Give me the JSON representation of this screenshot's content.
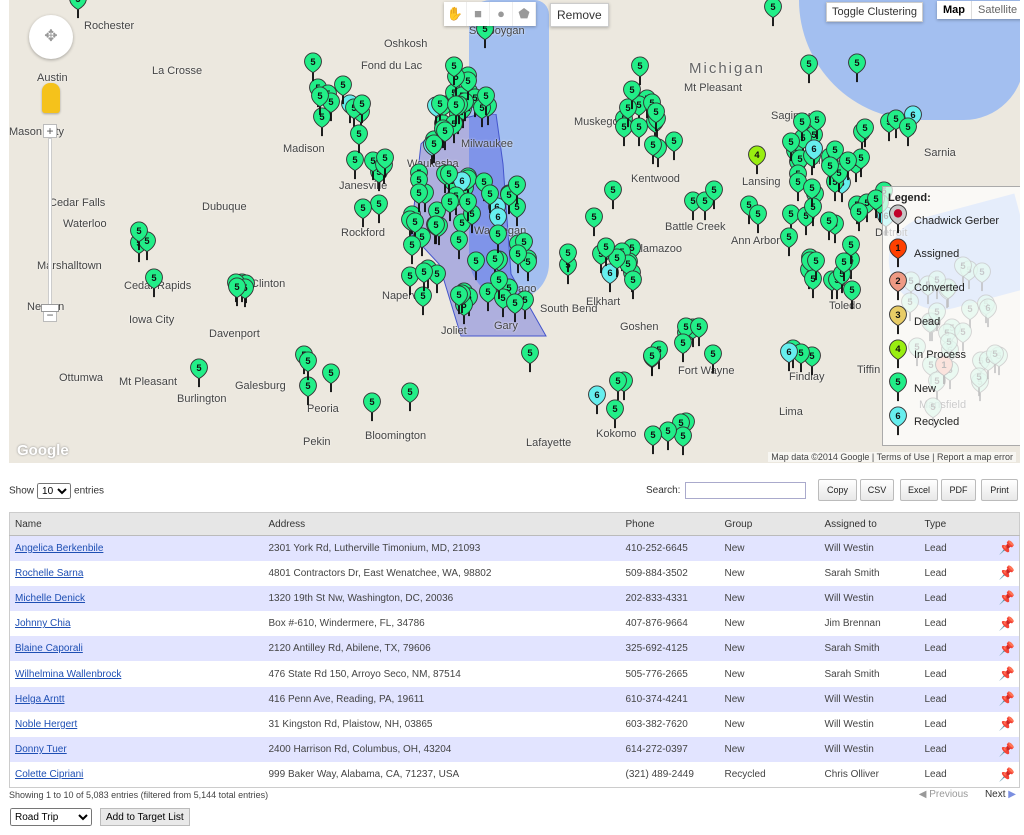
{
  "map": {
    "cities": [
      "Rochester",
      "La Crosse",
      "Austin",
      "Mason City",
      "Cedar Falls",
      "Waterloo",
      "Marshalltown",
      "Cedar Rapids",
      "Newton",
      "Iowa City",
      "Davenport",
      "Dubuque",
      "Madison",
      "Janesville",
      "Rockford",
      "Waukesha",
      "Milwaukee",
      "Sheboygan",
      "Oshkosh",
      "Fond du Lac",
      "Waukegan",
      "Chicago",
      "Naperville",
      "Joliet",
      "Gary",
      "South Bend",
      "Elkhart",
      "Goshen",
      "Kalamazoo",
      "Battle Creek",
      "Ann Arbor",
      "Detroit",
      "Lansing",
      "Kentwood",
      "Muskegon",
      "Mt Pleasant",
      "Saginaw",
      "Flint",
      "Sarnia",
      "Toledo",
      "Findlay",
      "Lima",
      "Fort Wayne",
      "Kokomo",
      "Lafayette",
      "Bloomington",
      "Peoria",
      "Galesburg",
      "Burlington",
      "Ottumwa",
      "Mt Pleasant",
      "Pekin",
      "Clinton",
      "Tiffin",
      "Mansfield",
      "Michigan"
    ],
    "marker_label": "5",
    "drawing_tools": [
      "hand-icon",
      "rectangle-icon",
      "circle-icon",
      "polygon-icon"
    ],
    "remove_label": "Remove",
    "toggle_clustering_label": "Toggle Clustering",
    "map_types": [
      "Map",
      "Satellite"
    ],
    "selected_map_type": "Map",
    "google_logo": "Google",
    "attribution": "Map data ©2014 Google",
    "terms": "Terms of Use",
    "report": "Report a map error",
    "legend": {
      "title": "Legend:",
      "items": [
        {
          "num": "",
          "label": "Chadwick Gerber",
          "color": "#c8c8c8"
        },
        {
          "num": "1",
          "label": "Assigned",
          "color": "#ff4000"
        },
        {
          "num": "2",
          "label": "Converted",
          "color": "#ee9a84"
        },
        {
          "num": "3",
          "label": "Dead",
          "color": "#e8cc66"
        },
        {
          "num": "4",
          "label": "In Process",
          "color": "#99ee11"
        },
        {
          "num": "5",
          "label": "New",
          "color": "#22ee88"
        },
        {
          "num": "6",
          "label": "Recycled",
          "color": "#66eeee"
        }
      ]
    }
  },
  "controls": {
    "show_label": "Show",
    "entries_value": "10",
    "entries_label": "entries",
    "search_label": "Search:",
    "search_value": "",
    "buttons": [
      "Copy",
      "CSV",
      "Excel",
      "PDF",
      "Print"
    ]
  },
  "table": {
    "columns": [
      "Name",
      "Address",
      "Phone",
      "Group",
      "Assigned to",
      "Type",
      ""
    ],
    "rows": [
      [
        "Angelica Berkenbile",
        "2301 York Rd, Lutherville Timonium, MD, 21093",
        "410-252-6645",
        "New",
        "Will Westin",
        "Lead"
      ],
      [
        "Rochelle Sarna",
        "4801 Contractors Dr, East Wenatchee, WA, 98802",
        "509-884-3502",
        "New",
        "Sarah Smith",
        "Lead"
      ],
      [
        "Michelle Denick",
        "1320 19th St Nw, Washington, DC, 20036",
        "202-833-4331",
        "New",
        "Will Westin",
        "Lead"
      ],
      [
        "Johnny Chia",
        "Box #-610, Windermere, FL, 34786",
        "407-876-9664",
        "New",
        "Jim Brennan",
        "Lead"
      ],
      [
        "Blaine Caporali",
        "2120 Antilley Rd, Abilene, TX, 79606",
        "325-692-4125",
        "New",
        "Sarah Smith",
        "Lead"
      ],
      [
        "Wilhelmina Wallenbrock",
        "476 State Rd 150, Arroyo Seco, NM, 87514",
        "505-776-2665",
        "New",
        "Sarah Smith",
        "Lead"
      ],
      [
        "Helga Arntt",
        "416 Penn Ave, Reading, PA, 19611",
        "610-374-4241",
        "New",
        "Will Westin",
        "Lead"
      ],
      [
        "Noble Hergert",
        "31 Kingston Rd, Plaistow, NH, 03865",
        "603-382-7620",
        "New",
        "Will Westin",
        "Lead"
      ],
      [
        "Donny Tuer",
        "2400 Harrison Rd, Columbus, OH, 43204",
        "614-272-0397",
        "New",
        "Will Westin",
        "Lead"
      ],
      [
        "Colette Cipriani",
        "999 Baker Way, Alabama, CA, 71237, USA",
        "(321) 489-2449",
        "Recycled",
        "Chris Olliver",
        "Lead"
      ]
    ]
  },
  "footer": {
    "info": "Showing 1 to 10 of 5,083 entries (filtered from 5,144 total entries)",
    "previous": "Previous",
    "next": "Next",
    "list_select": "Road Trip",
    "add_button": "Add to Target List"
  }
}
